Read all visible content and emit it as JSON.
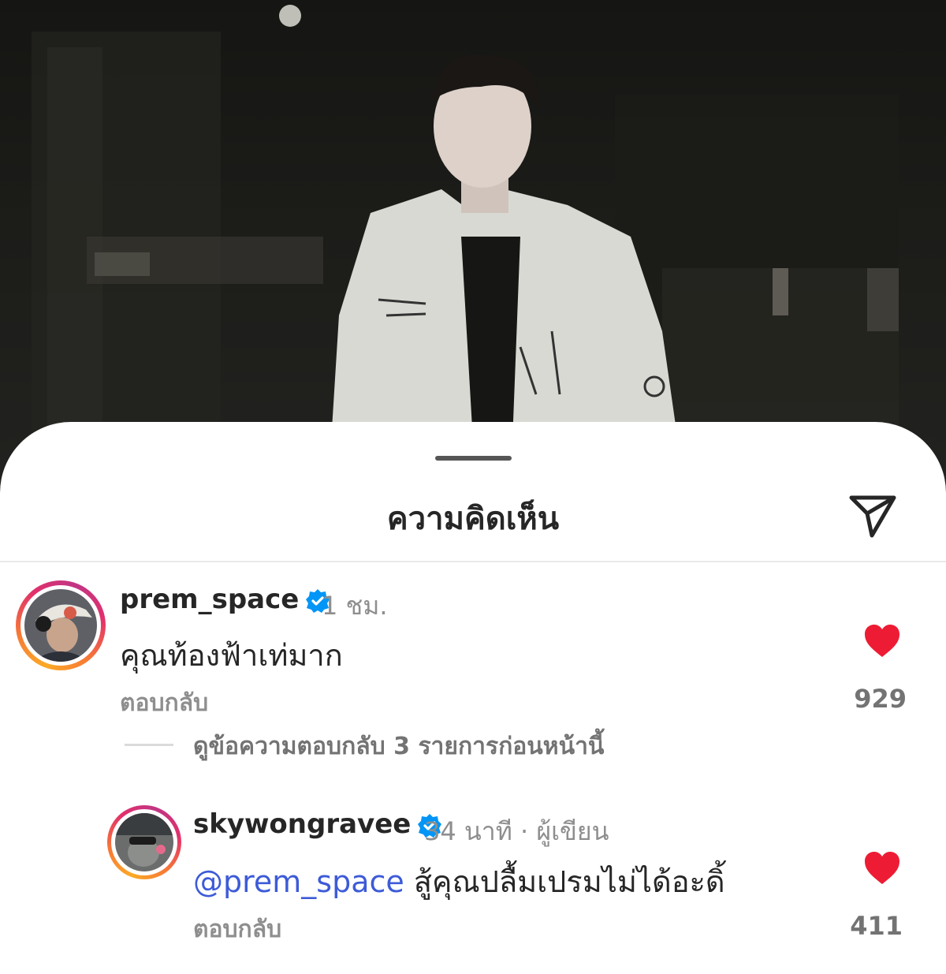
{
  "sheet": {
    "title": "ความคิดเห็น"
  },
  "comments": [
    {
      "username": "prem_space",
      "verified": true,
      "time": "1 ชม.",
      "text": "คุณท้องฟ้าเท่มาก",
      "reply_label": "ตอบกลับ",
      "liked": true,
      "like_count": "929"
    }
  ],
  "view_previous_replies": "ดูข้อความตอบกลับ 3 รายการก่อนหน้านี้",
  "replies": [
    {
      "username": "skywongravee",
      "verified": true,
      "time": "34 นาที",
      "separator": "·",
      "author_tag": "ผู้เขียน",
      "mention": "@prem_space",
      "text": " สู้คุณปลื้มเปรมไม่ได้อะดิ้",
      "reply_label": "ตอบกลับ",
      "liked": true,
      "like_count": "411"
    }
  ],
  "colors": {
    "heart": "#ed1c34",
    "verified": "#0095f6",
    "mention": "#3d5bd8"
  },
  "icons": [
    "share-icon",
    "verified-badge-icon",
    "heart-icon"
  ]
}
